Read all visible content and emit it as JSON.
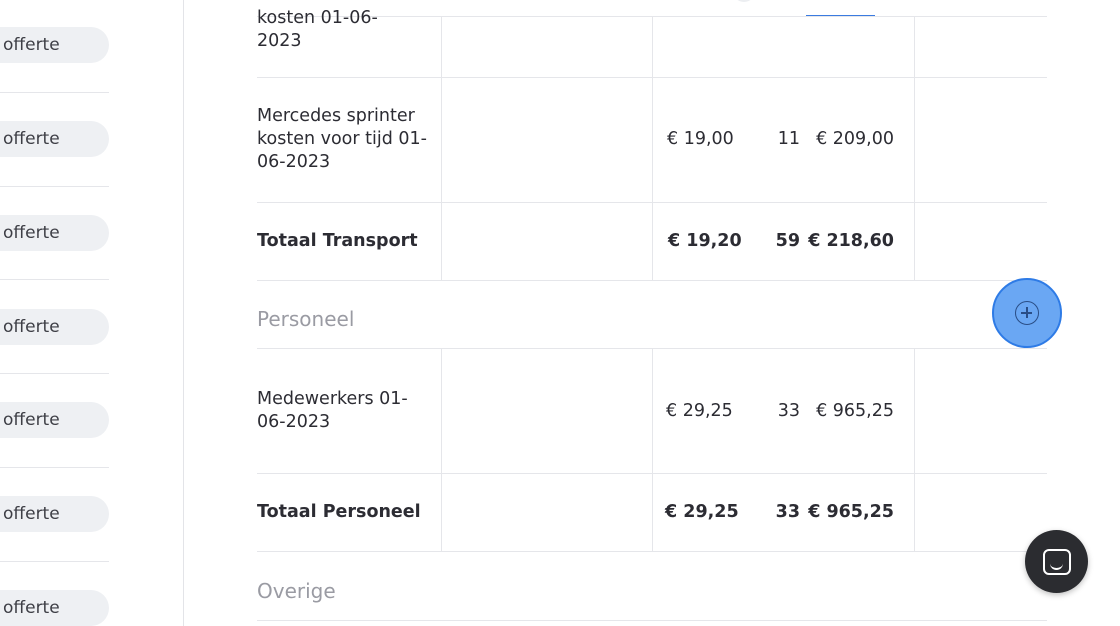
{
  "sidebar": {
    "pills": [
      "offerte",
      "offerte",
      "offerte",
      "offerte",
      "offerte",
      "offerte",
      "offerte"
    ]
  },
  "table": {
    "rows": [
      {
        "desc": "kosten 01-06-2023"
      },
      {
        "desc": "Mercedes sprinter kosten voor tijd 01-06-2023",
        "price": "€ 19,00",
        "qty": "11",
        "total": "€ 209,00"
      },
      {
        "desc": "Totaal Transport",
        "price": "€ 19,20",
        "qty": "59",
        "total": "€ 218,60"
      },
      {
        "desc": "Medewerkers 01-06-2023",
        "price": "€ 29,25",
        "qty": "33",
        "total": "€ 965,25"
      },
      {
        "desc": "Totaal Personeel",
        "price": "€ 29,25",
        "qty": "33",
        "total": "€ 965,25"
      }
    ],
    "sections": {
      "personeel": "Personeel",
      "overige": "Overige"
    }
  },
  "icons": {
    "add": "plus-circle-icon",
    "chat": "chat-icon"
  },
  "colors": {
    "accent": "#2e7be6",
    "add_button_fill": "#6aa7f3",
    "chat_button": "#2b2c30",
    "section_text": "#9a9ba3"
  }
}
